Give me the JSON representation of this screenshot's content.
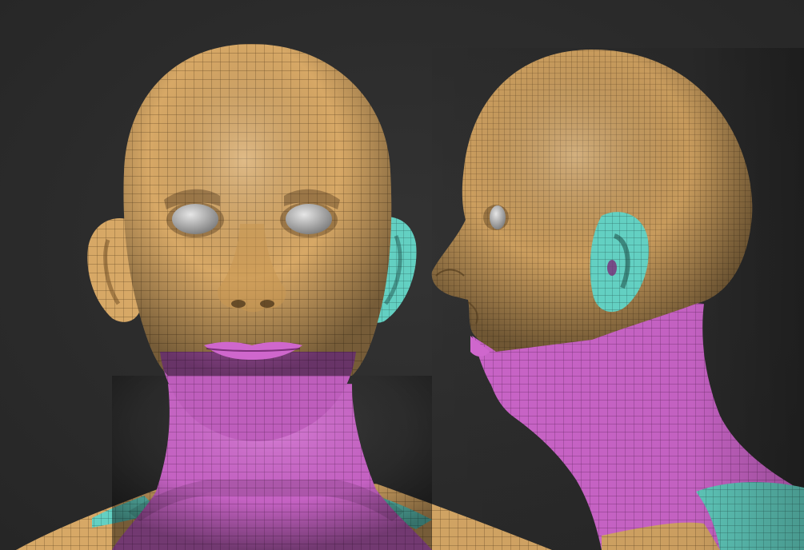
{
  "scene": {
    "background_color": "#2b2b2b",
    "polygroup_colors": {
      "face_and_scalp": "#d7a866",
      "jaw_and_neck": "#cf67cd",
      "ears_and_shoulder": "#63d0c2",
      "eyes": "#bdbdbd",
      "wireframe": "#3a2a18"
    },
    "views": [
      "front-view",
      "side-view"
    ]
  }
}
